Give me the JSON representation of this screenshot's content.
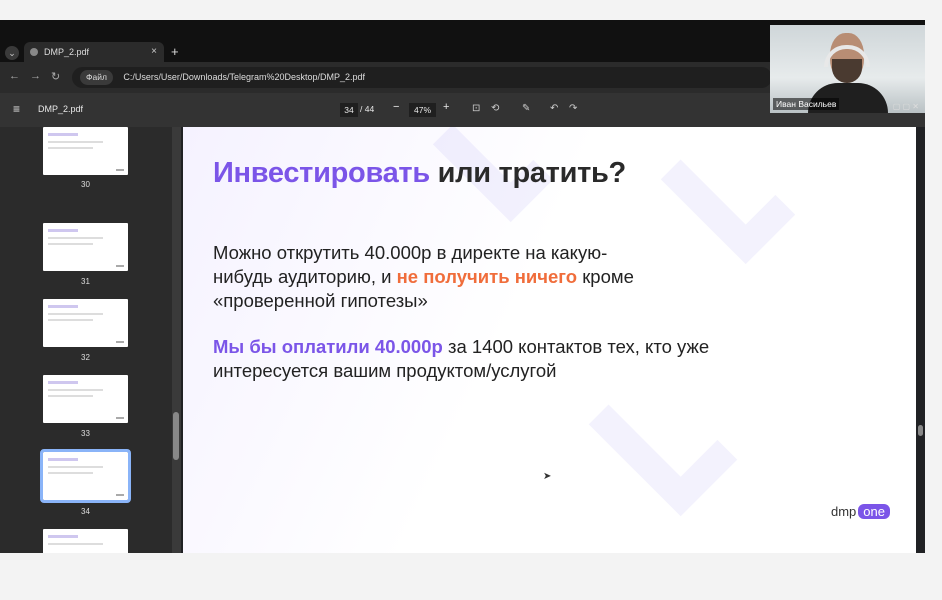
{
  "browser": {
    "tab_title": "DMP_2.pdf",
    "tab_close": "×",
    "new_tab": "+",
    "menu": "⌄",
    "chip": "Файл",
    "address": "C:/Users/User/Downloads/Telegram%20Desktop/DMP_2.pdf"
  },
  "pdf_toolbar": {
    "filename": "DMP_2.pdf",
    "page_current": "34",
    "page_total": "/ 44",
    "zoom": "47%",
    "zoom_out": "−",
    "zoom_in": "+"
  },
  "sidebar": {
    "thumbnails": [
      {
        "number": "30"
      },
      {
        "number": "31"
      },
      {
        "number": "32"
      },
      {
        "number": "33"
      },
      {
        "number": "34",
        "selected": true
      }
    ]
  },
  "slide": {
    "title_accent": "Инвестировать",
    "title_rest": " или тратить?",
    "para1_a": "Можно открутить 40.000р в директе на какую-нибудь аудиторию, и ",
    "para1_hl": "не получить ничего",
    "para1_b": " кроме «проверенной гипотезы»",
    "para2_hl": "Мы бы оплатили 40.000р",
    "para2_b": " за 1400 контактов тех, кто уже интересуется вашим продуктом/услугой",
    "logo_text": "dmp",
    "logo_badge": "one"
  },
  "webcam": {
    "name": "Иван Васильев"
  },
  "colors": {
    "accent_purple": "#7b55e8",
    "accent_orange": "#f06d3b"
  }
}
